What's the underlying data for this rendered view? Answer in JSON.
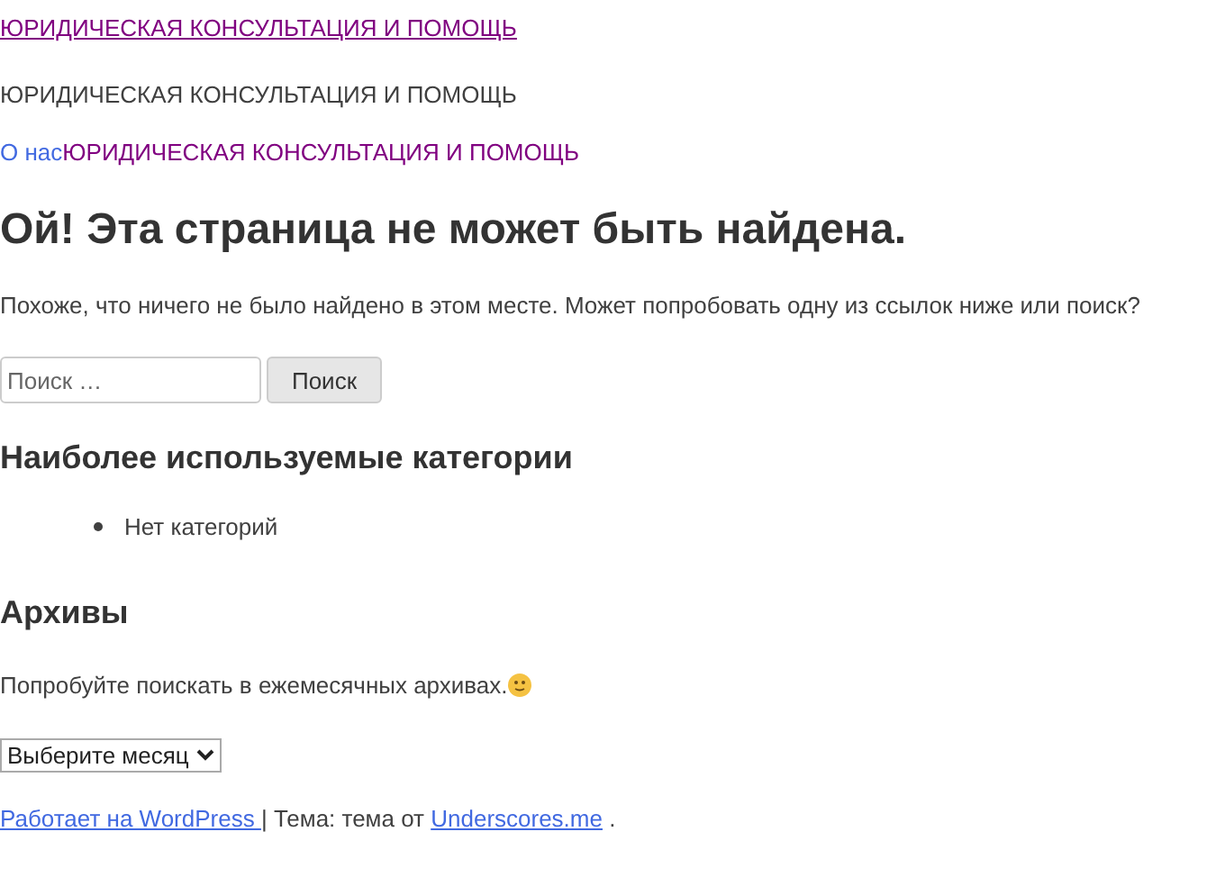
{
  "site_title": {
    "text": "ЮРИДИЧЕСКАЯ КОНСУЛЬТАЦИЯ И ПОМОЩЬ",
    "visited": true
  },
  "site_description": "ЮРИДИЧЕСКАЯ КОНСУЛЬТАЦИЯ И ПОМОЩЬ",
  "nav": [
    {
      "label": "О нас",
      "visited": false
    },
    {
      "label": "ЮРИДИЧЕСКАЯ КОНСУЛЬТАЦИЯ И ПОМОЩЬ",
      "visited": true
    }
  ],
  "heading": "Ой! Эта страница не может быть найдена.",
  "message": "Похоже, что ничего не было найдено в этом месте. Может попробовать одну из ссылок ниже или поиск?",
  "search": {
    "placeholder": "Поиск …",
    "button": "Поиск"
  },
  "categories": {
    "title": "Наиболее используемые категории",
    "items": [
      "Нет категорий"
    ]
  },
  "archives": {
    "title": "Архивы",
    "text": "Попробуйте поискать в ежемесячных архивах.",
    "select": "Выберите месяц"
  },
  "footer": {
    "powered_link": "Работает на WordPress ",
    "separator": "| Тема: тема от ",
    "theme_link": "Underscores.me",
    "end": " ."
  }
}
